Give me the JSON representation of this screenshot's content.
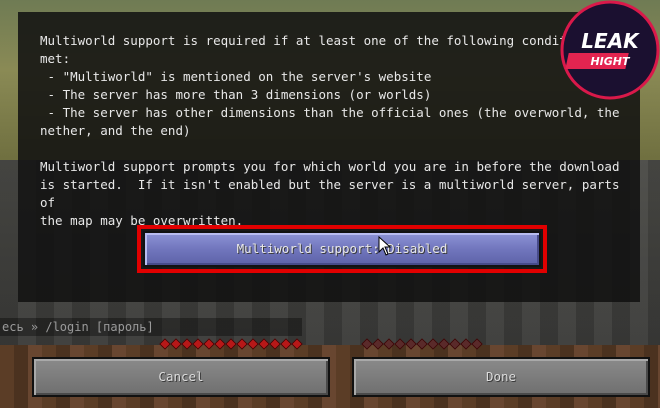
{
  "chat": {
    "text": "есь » /login [пароль]"
  },
  "dialog": {
    "lines": [
      "Multiworld support is required if at least one of the following condit",
      "met:",
      " - \"Multiworld\" is mentioned on the server's website",
      " - The server has more than 3 dimensions (or worlds)",
      " - The server has other dimensions than the official ones (the overworld, the",
      "nether, and the end)",
      "",
      "Multiworld support prompts you for which world you are in before the download",
      "is started.  If it isn't enabled but the server is a multiworld server, parts of",
      "the map may be overwritten."
    ]
  },
  "buttons": {
    "multiworld": "Multiworld support: Disabled",
    "cancel": "Cancel",
    "done": "Done"
  },
  "watermark": {
    "line1": "LEAK",
    "line2": "HIGHT"
  },
  "colors": {
    "highlight": "#e10000",
    "button_selected": "#7176bd"
  }
}
